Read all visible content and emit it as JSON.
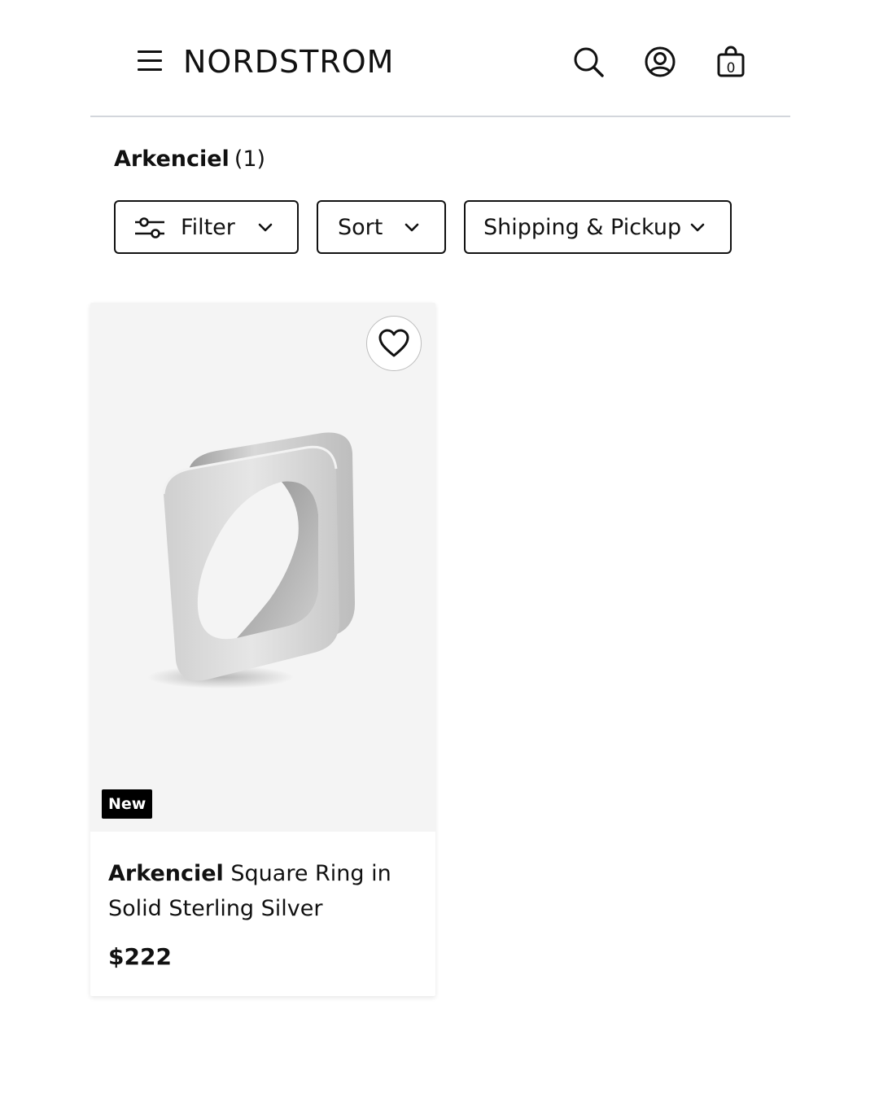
{
  "header": {
    "logo_text": "NORDSTROM",
    "bag_count": "0",
    "icons": [
      "menu-icon",
      "search-icon",
      "account-icon",
      "bag-icon"
    ]
  },
  "page": {
    "brand": "Arkenciel",
    "result_count": "(1)"
  },
  "toolbar": {
    "filter_label": "Filter",
    "sort_label": "Sort",
    "shipping_label": "Shipping & Pickup"
  },
  "products": [
    {
      "badge": "New",
      "brand": "Arkenciel",
      "name": "Square Ring in Solid Sterling Silver",
      "price": "$222",
      "image_icon": "square-ring-image"
    }
  ],
  "colors": {
    "text": "#111111",
    "divider": "#d3d6dc",
    "image_bg": "#f4f4f4",
    "badge_bg": "#000000"
  }
}
